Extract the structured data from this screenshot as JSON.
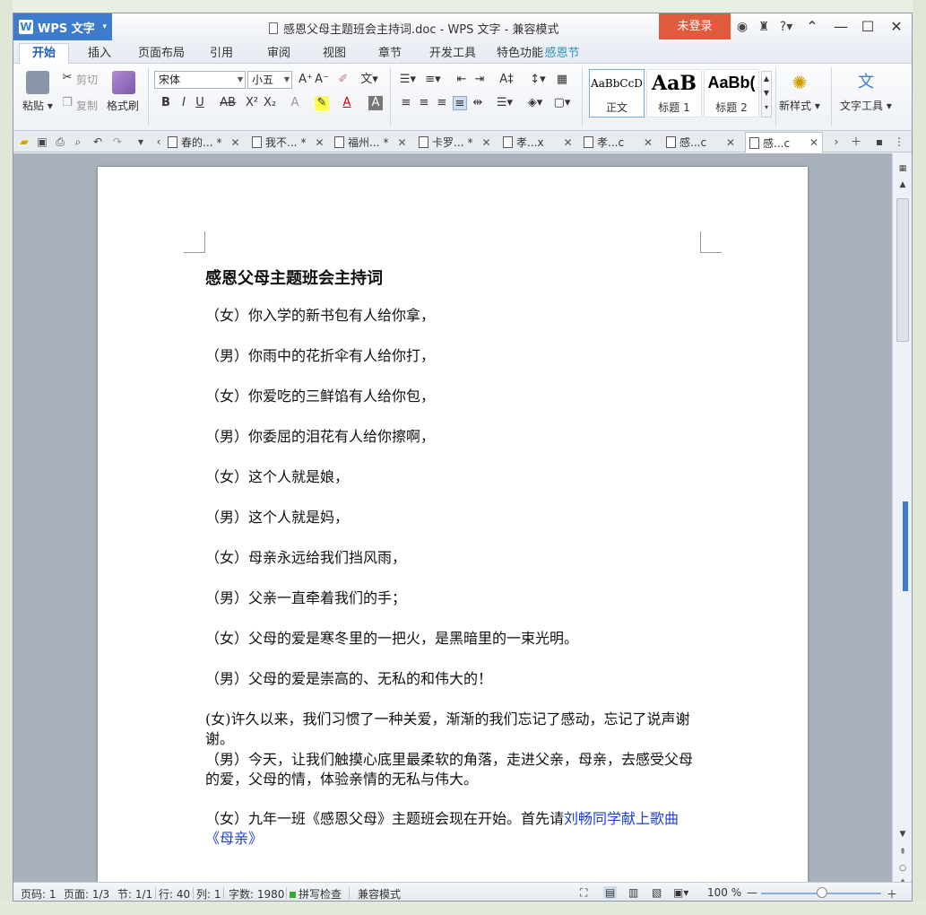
{
  "window": {
    "app_name": "WPS 文字",
    "title": "感恩父母主题班会主持词.doc - WPS 文字 - 兼容模式",
    "login_label": "未登录"
  },
  "menu": {
    "tabs": [
      "开始",
      "插入",
      "页面布局",
      "引用",
      "审阅",
      "视图",
      "章节",
      "开发工具",
      "特色功能"
    ],
    "active": "开始",
    "banner": "感恩节"
  },
  "ribbon": {
    "paste": "粘贴",
    "cut": "剪切",
    "copy": "复制",
    "format_painter": "格式刷",
    "font_name": "宋体",
    "font_size": "小五",
    "styles": [
      {
        "sample": "AaBbCcD",
        "label": "正文"
      },
      {
        "sample": "AaB",
        "label": "标题 1"
      },
      {
        "sample": "AaBb(",
        "label": "标题 2"
      }
    ],
    "new_style": "新样式",
    "text_tools": "文字工具"
  },
  "doc_tabs": [
    {
      "label": "春的...",
      "modified": "*"
    },
    {
      "label": "我不...",
      "modified": "*"
    },
    {
      "label": "福州...",
      "modified": "*"
    },
    {
      "label": "卡罗...",
      "modified": "*"
    },
    {
      "label": "孝...x",
      "modified": ""
    },
    {
      "label": "孝...c",
      "modified": ""
    },
    {
      "label": "感...c",
      "modified": ""
    },
    {
      "label": "感...c",
      "modified": ""
    }
  ],
  "document": {
    "heading": "感恩父母主题班会主持词",
    "paragraphs": [
      "（女）你入学的新书包有人给你拿，",
      "（男）你雨中的花折伞有人给你打，",
      "（女）你爱吃的三鲜馅有人给你包，",
      "（男）你委屈的泪花有人给你擦啊，",
      "（女）这个人就是娘，",
      "（男）这个人就是妈，",
      "（女）母亲永远给我们挡风雨，",
      "（男）父亲一直牵着我们的手；",
      "（女）父母的爱是寒冬里的一把火，是黑暗里的一束光明。",
      "（男）父母的爱是崇高的、无私的和伟大的！",
      "(女)许久以来，我们习惯了一种关爱，渐渐的我们忘记了感动，忘记了说声谢谢。",
      "（男）今天，让我们触摸心底里最柔软的角落，走进父亲，母亲，去感受父母的爱，父母的情，体验亲情的无私与伟大。"
    ],
    "last_para_plain": "（女）九年一班《感恩父母》主题班会现在开始。首先请",
    "last_para_link": "刘畅同学献上歌曲《母亲》"
  },
  "status": {
    "page": "页码: 1",
    "pages": "页面: 1/3",
    "section": "节: 1/1",
    "row": "行: 40",
    "col": "列: 1",
    "word_count": "字数: 1980",
    "spell": "拼写检查",
    "compat": "兼容模式",
    "zoom": "100 %"
  },
  "colors": {
    "accent": "#3d7ccc",
    "login": "#e05a3c",
    "link": "#1f3fd0"
  }
}
